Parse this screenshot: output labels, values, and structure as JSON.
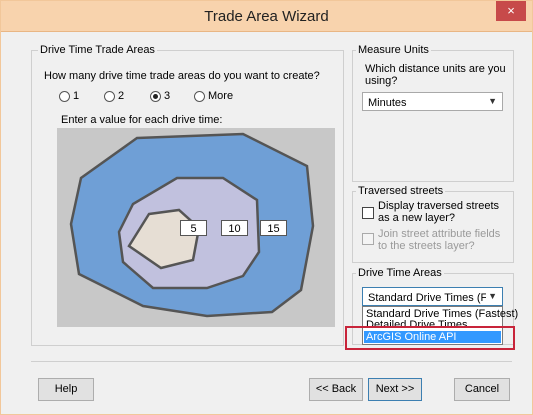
{
  "window": {
    "title": "Trade Area Wizard",
    "close_label": "×"
  },
  "drive_time_group": {
    "label": "Drive Time Trade Areas",
    "question": "How many drive time trade areas do you want to create?",
    "options": [
      {
        "label": "1",
        "checked": false
      },
      {
        "label": "2",
        "checked": false
      },
      {
        "label": "3",
        "checked": true
      },
      {
        "label": "More",
        "checked": false
      }
    ],
    "enter_value_label": "Enter a value for each drive time:",
    "values": [
      "5",
      "10",
      "15"
    ]
  },
  "measure_units": {
    "label": "Measure Units",
    "question_line1": "Which distance units are you",
    "question_line2": "using?",
    "selected": "Minutes"
  },
  "traversed_streets": {
    "label": "Traversed streets",
    "display_line1": "Display traversed streets",
    "display_line2": "as a new layer?",
    "join_line1": "Join street attribute fields",
    "join_line2": "to the streets layer?"
  },
  "drive_time_areas": {
    "label": "Drive Time Areas",
    "selected": "Standard Drive Times (Fast",
    "options": [
      "Standard Drive Times (Fastest)",
      "Detailed Drive Times",
      "ArcGIS Online API"
    ],
    "highlighted_index": 2
  },
  "buttons": {
    "help": "Help",
    "back": "<< Back",
    "next": "Next >>",
    "cancel": "Cancel"
  },
  "colors": {
    "outer_area": "#6f9fd6",
    "middle_area": "#c1c1de",
    "inner_area": "#e6ded4",
    "border": "#555555",
    "highlight": "#c8243a"
  }
}
